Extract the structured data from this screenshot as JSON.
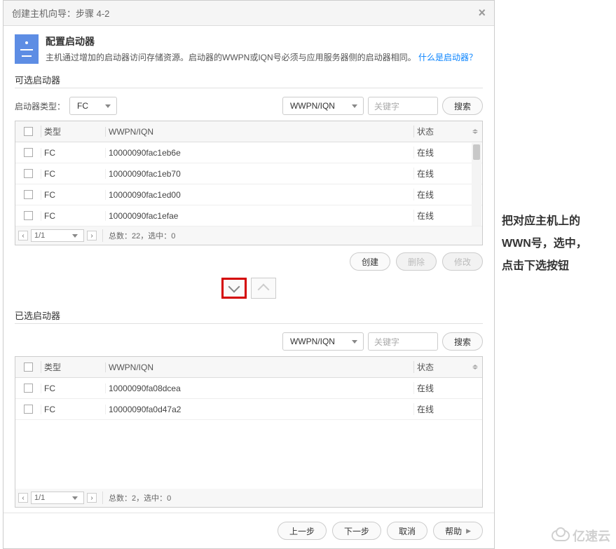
{
  "dialog": {
    "title": "创建主机向导：步骤 4-2"
  },
  "info": {
    "heading": "配置启动器",
    "body": "主机通过增加的启动器访问存储资源。启动器的WWPN或IQN号必须与应用服务器侧的启动器相同。",
    "link": "什么是启动器？"
  },
  "available": {
    "title": "可选启动器",
    "type_label": "启动器类型：",
    "type_value": "FC",
    "search_field_label": "WWPN/IQN",
    "search_placeholder": "关键字",
    "search_btn": "搜索",
    "cols": {
      "type": "类型",
      "wwpn": "WWPN/IQN",
      "status": "状态"
    },
    "rows": [
      {
        "type": "FC",
        "wwpn": "10000090fac1eb6e",
        "status": "在线"
      },
      {
        "type": "FC",
        "wwpn": "10000090fac1eb70",
        "status": "在线"
      },
      {
        "type": "FC",
        "wwpn": "10000090fac1ed00",
        "status": "在线"
      },
      {
        "type": "FC",
        "wwpn": "10000090fac1efae",
        "status": "在线"
      }
    ],
    "page": "1/1",
    "summary": "总数：22，选中：0"
  },
  "actions": {
    "create": "创建",
    "delete": "删除",
    "modify": "修改"
  },
  "selected": {
    "title": "已选启动器",
    "search_field_label": "WWPN/IQN",
    "search_placeholder": "关键字",
    "search_btn": "搜索",
    "cols": {
      "type": "类型",
      "wwpn": "WWPN/IQN",
      "status": "状态"
    },
    "rows": [
      {
        "type": "FC",
        "wwpn": "10000090fa08dcea",
        "status": "在线"
      },
      {
        "type": "FC",
        "wwpn": "10000090fa0d47a2",
        "status": "在线"
      }
    ],
    "page": "1/1",
    "summary": "总数：2，选中：0"
  },
  "footer": {
    "prev": "上一步",
    "next": "下一步",
    "cancel": "取消",
    "help": "帮助"
  },
  "annotation": {
    "l1": "把对应主机上的",
    "l2": "WWN号，选中，",
    "l3": "点击下选按钮"
  },
  "watermark": "亿速云"
}
